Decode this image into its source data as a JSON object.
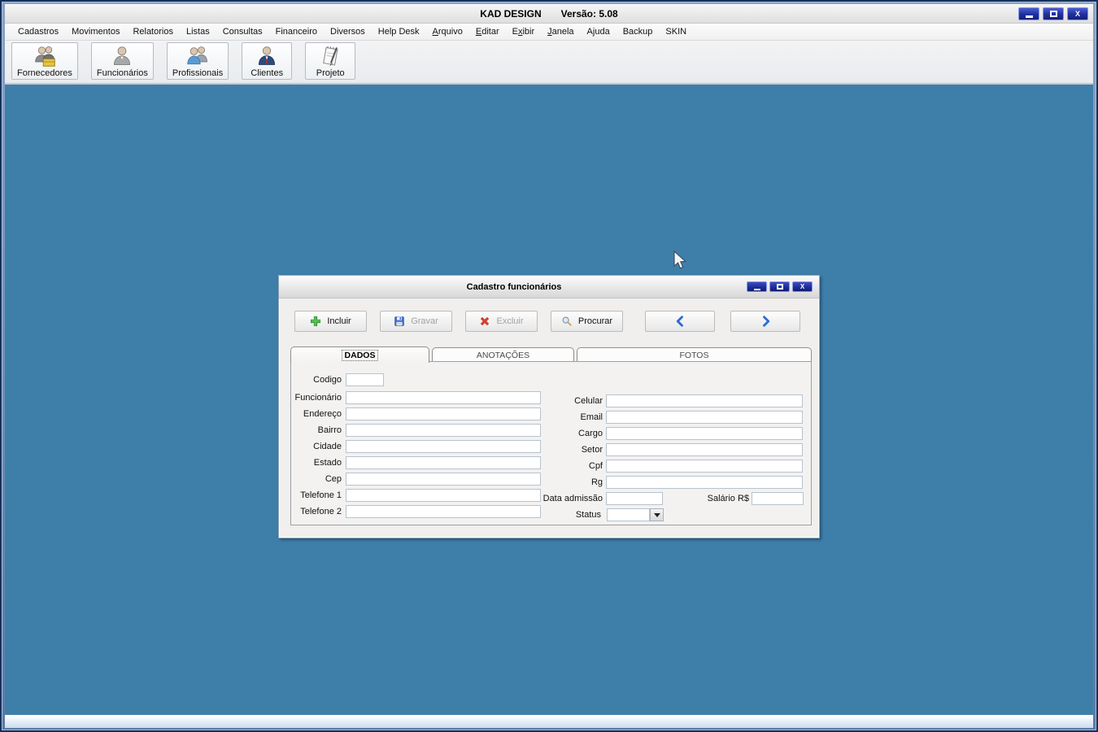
{
  "titlebar": {
    "title": "KAD DESIGN",
    "version": "Versão: 5.08",
    "close_glyph": "X"
  },
  "menu": {
    "items": [
      {
        "label": "Cadastros",
        "u": -1
      },
      {
        "label": "Movimentos",
        "u": -1
      },
      {
        "label": "Relatorios",
        "u": -1
      },
      {
        "label": "Listas",
        "u": -1
      },
      {
        "label": "Consultas",
        "u": -1
      },
      {
        "label": "Financeiro",
        "u": -1
      },
      {
        "label": "Diversos",
        "u": -1
      },
      {
        "label": "Help Desk",
        "u": -1
      },
      {
        "label": "Arquivo",
        "u": 0
      },
      {
        "label": "Editar",
        "u": 0
      },
      {
        "label": "Exibir",
        "u": 1
      },
      {
        "label": "Janela",
        "u": 0
      },
      {
        "label": "Ajuda",
        "u": -1
      },
      {
        "label": "Backup",
        "u": -1
      },
      {
        "label": "SKIN",
        "u": -1
      }
    ]
  },
  "toolbar": {
    "buttons": [
      {
        "label": "Fornecedores",
        "icon": "suppliers-people-icon"
      },
      {
        "label": "Funcionários",
        "icon": "employee-person-icon"
      },
      {
        "label": "Profissionais",
        "icon": "professionals-people-icon"
      },
      {
        "label": "Clientes",
        "icon": "client-person-icon"
      },
      {
        "label": "Projeto",
        "icon": "project-notepad-icon"
      }
    ]
  },
  "child_window": {
    "title": "Cadastro funcionários",
    "close_glyph": "X",
    "actions": {
      "incluir": {
        "label": "Incluir",
        "enabled": true
      },
      "gravar": {
        "label": "Gravar",
        "enabled": false
      },
      "excluir": {
        "label": "Excluir",
        "enabled": false
      },
      "procurar": {
        "label": "Procurar",
        "enabled": true
      }
    },
    "tabs": [
      {
        "label": "DADOS",
        "selected": true
      },
      {
        "label": "ANOTAÇÕES",
        "selected": false
      },
      {
        "label": "FOTOS",
        "selected": false
      }
    ],
    "fields": {
      "codigo": {
        "label": "Codigo",
        "value": ""
      },
      "funcionario": {
        "label": "Funcionário",
        "value": ""
      },
      "endereco": {
        "label": "Endereço",
        "value": ""
      },
      "bairro": {
        "label": "Bairro",
        "value": ""
      },
      "cidade": {
        "label": "Cidade",
        "value": ""
      },
      "estado": {
        "label": "Estado",
        "value": ""
      },
      "cep": {
        "label": "Cep",
        "value": ""
      },
      "telefone1": {
        "label": "Telefone 1",
        "value": ""
      },
      "telefone2": {
        "label": "Telefone 2",
        "value": ""
      },
      "celular": {
        "label": "Celular",
        "value": ""
      },
      "email": {
        "label": "Email",
        "value": ""
      },
      "cargo": {
        "label": "Cargo",
        "value": ""
      },
      "setor": {
        "label": "Setor",
        "value": ""
      },
      "cpf": {
        "label": "Cpf",
        "value": ""
      },
      "rg": {
        "label": "Rg",
        "value": ""
      },
      "data_admissao": {
        "label": "Data admissão",
        "value": ""
      },
      "salario": {
        "label": "Salário R$",
        "value": ""
      },
      "status": {
        "label": "Status",
        "value": ""
      }
    }
  },
  "colors": {
    "mdi_background": "#3e7fa9",
    "frame_navy": "#14315a",
    "control_button_navy": "#1c2b94",
    "nav_arrow_blue": "#2a6bd3",
    "incluir_green": "#4cb748",
    "excluir_red": "#d6402f",
    "gravar_blue": "#3f6fd6"
  }
}
